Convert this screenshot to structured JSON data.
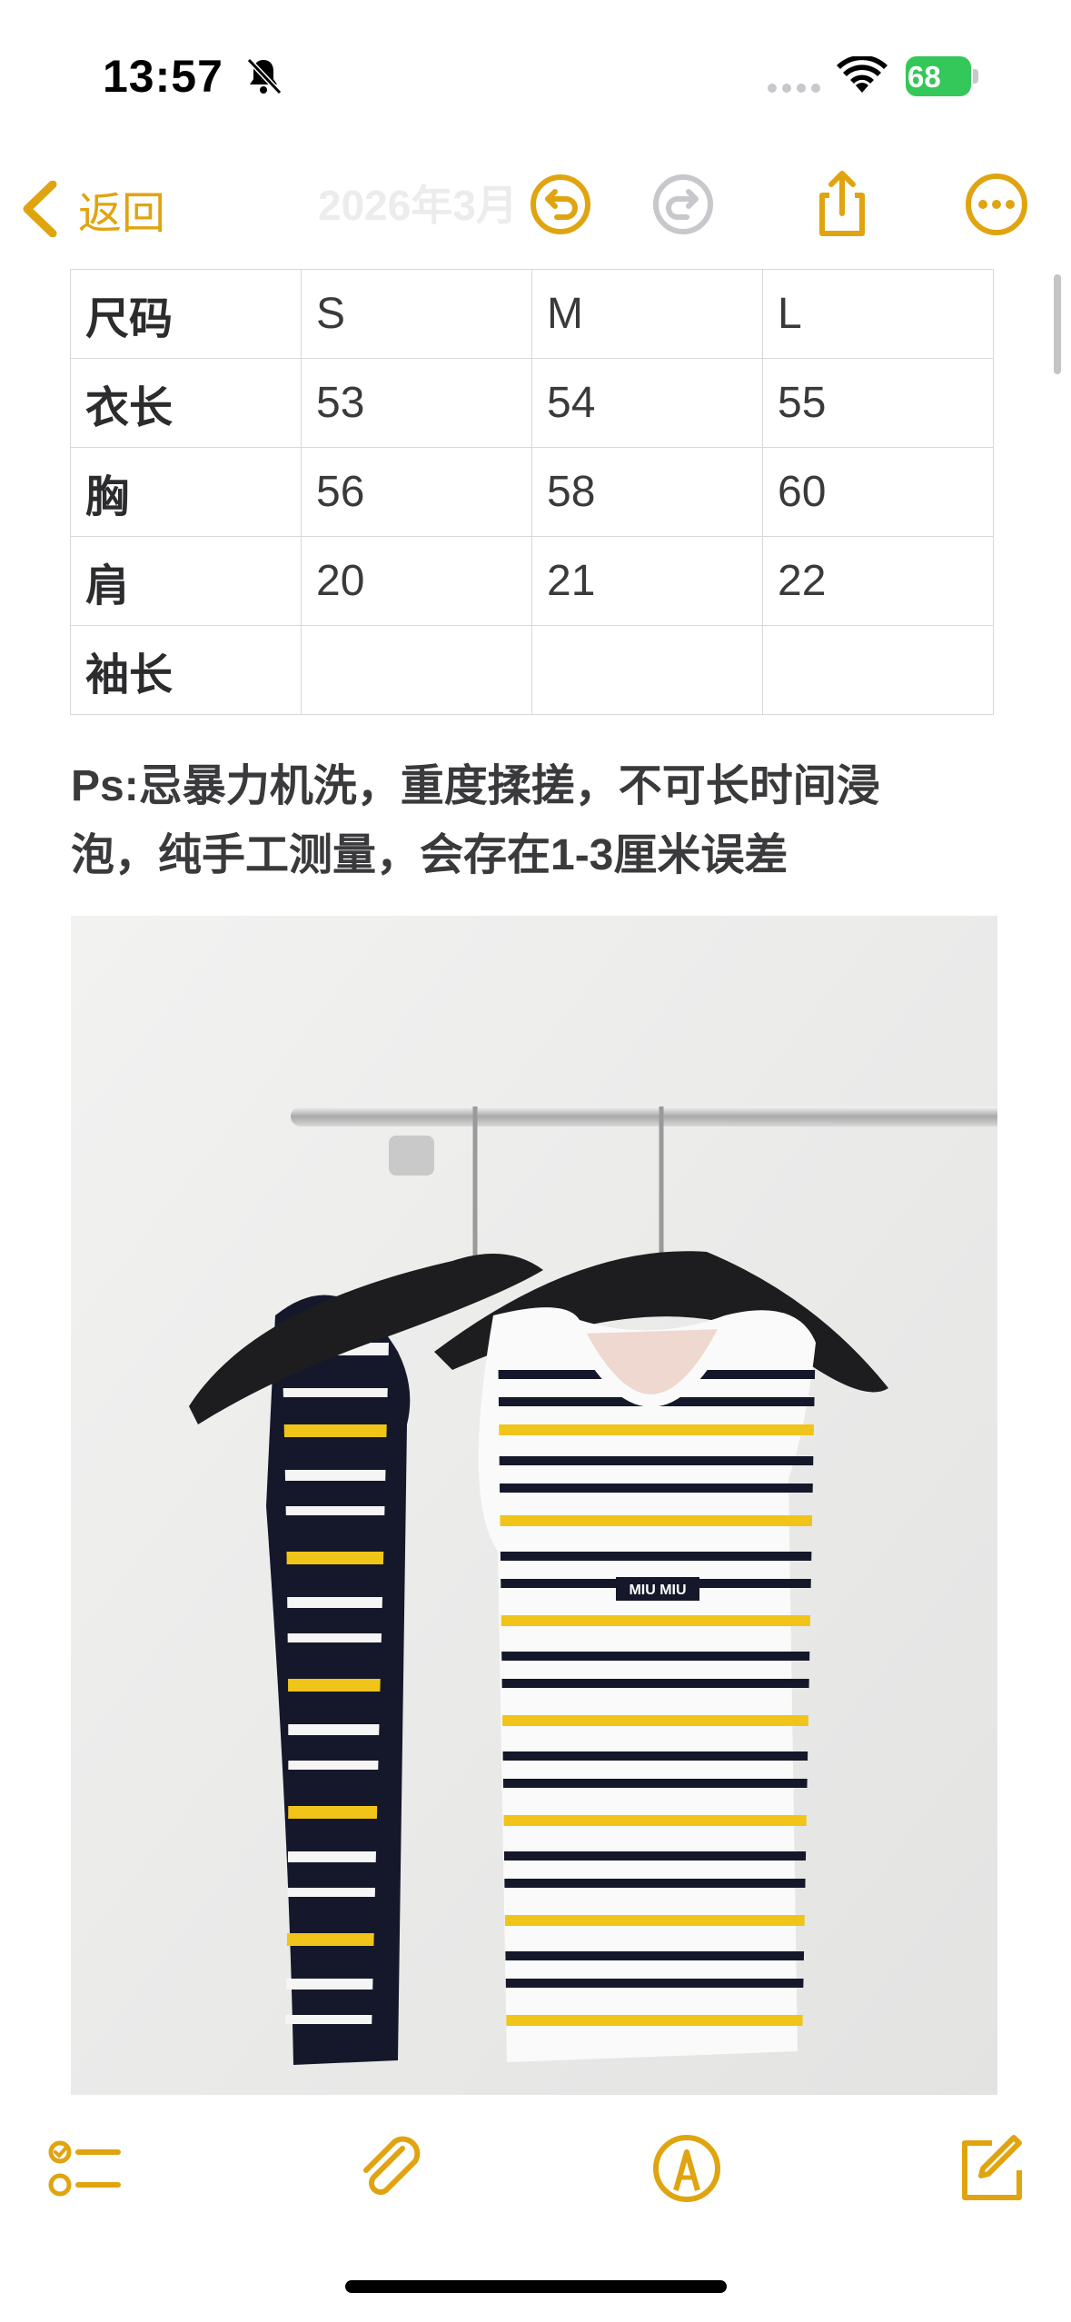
{
  "status": {
    "time": "13:57",
    "battery": "68"
  },
  "nav": {
    "back_label": "返回",
    "faded_title": "2026年3月"
  },
  "table": {
    "rows": [
      [
        "尺码",
        "S",
        "M",
        "L"
      ],
      [
        "衣长",
        "53",
        "54",
        "55"
      ],
      [
        "胸",
        "56",
        "58",
        "60"
      ],
      [
        "肩",
        "20",
        "21",
        "22"
      ],
      [
        "袖长",
        "",
        "",
        ""
      ]
    ]
  },
  "note": {
    "line1": "Ps:忌暴力机洗，重度揉搓，不可长时间浸",
    "line2": "泡，纯手工测量，会存在1-3厘米误差"
  },
  "photo": {
    "label_text": "MIU MIU"
  },
  "colors": {
    "accent": "#e0a410",
    "stripe_yellow": "#f0c419",
    "navy": "#15182a"
  },
  "icons": [
    "chevron-left-icon",
    "undo-icon",
    "redo-icon",
    "share-icon",
    "more-icon",
    "checklist-icon",
    "paperclip-icon",
    "markup-pen-icon",
    "compose-icon",
    "bell-slash-icon",
    "wifi-icon"
  ]
}
